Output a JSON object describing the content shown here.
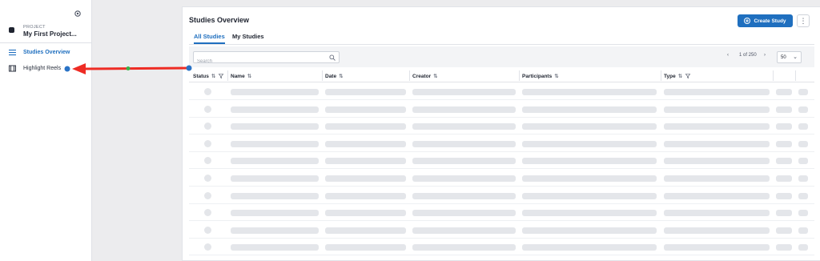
{
  "sidebar": {
    "project_kicker": "PROJECT",
    "project_name": "My First Project...",
    "items": [
      {
        "label": "Studies Overview",
        "icon": "list-icon",
        "active": true
      },
      {
        "label": "Highlight Reels",
        "icon": "film-icon",
        "active": false
      }
    ]
  },
  "main": {
    "title": "Studies Overview",
    "create_label": "Create Study",
    "more_label": "⋮",
    "tabs": [
      {
        "label": "All Studies",
        "active": true
      },
      {
        "label": "My Studies",
        "active": false
      }
    ],
    "search": {
      "placeholder": "Search",
      "value": ""
    },
    "pagination": {
      "prev": "‹",
      "text": "1 of 250",
      "next": "›"
    },
    "page_size": "50",
    "columns": [
      {
        "label": "Status",
        "sort": "⇅",
        "filter": true
      },
      {
        "label": "Name",
        "sort": "⇅",
        "filter": false
      },
      {
        "label": "Date",
        "sort": "⇅",
        "filter": false
      },
      {
        "label": "Creator",
        "sort": "⇅",
        "filter": false
      },
      {
        "label": "Participants",
        "sort": "⇅",
        "filter": false
      },
      {
        "label": "Type",
        "sort": "⇅",
        "filter": true
      }
    ],
    "loading_rows": 10
  },
  "colors": {
    "accent": "#1f6fbf",
    "annotation_arrow": "#ee2c24",
    "annotation_start_dot": "#2a73c6",
    "annotation_end_dot": "#2a73c6",
    "annotation_mid_dot": "#38b24a"
  }
}
